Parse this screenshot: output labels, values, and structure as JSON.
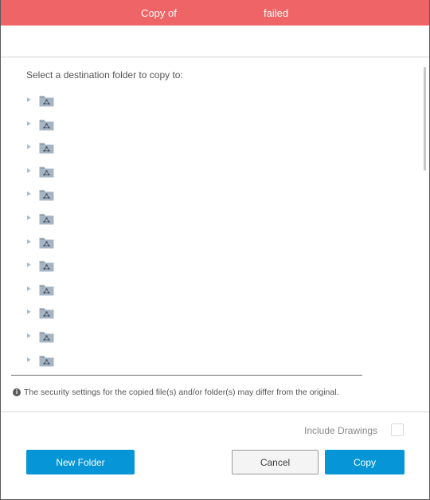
{
  "banner": {
    "copy_of": "Copy of",
    "status": "failed",
    "color": "#ef6466"
  },
  "prompt": "Select a destination folder to copy to:",
  "tree": {
    "items": [
      {
        "icon": "shared-folder-icon",
        "expandable": true
      },
      {
        "icon": "shared-folder-icon",
        "expandable": true
      },
      {
        "icon": "shared-folder-icon",
        "expandable": true
      },
      {
        "icon": "shared-folder-icon",
        "expandable": true
      },
      {
        "icon": "shared-folder-icon",
        "expandable": true
      },
      {
        "icon": "shared-folder-icon",
        "expandable": true
      },
      {
        "icon": "shared-folder-icon",
        "expandable": true
      },
      {
        "icon": "shared-folder-icon",
        "expandable": true
      },
      {
        "icon": "shared-folder-icon",
        "expandable": true
      },
      {
        "icon": "shared-folder-icon",
        "expandable": true
      },
      {
        "icon": "shared-folder-icon",
        "expandable": true
      },
      {
        "icon": "shared-folder-icon",
        "expandable": true
      },
      {
        "icon": "shared-folder-icon",
        "expandable": true
      }
    ]
  },
  "notice": {
    "icon": "info-icon",
    "text": "The security settings for the copied file(s) and/or folder(s) may differ from the original."
  },
  "options": {
    "include_drawings_label": "Include Drawings",
    "include_drawings_checked": false
  },
  "buttons": {
    "new_folder": "New Folder",
    "cancel": "Cancel",
    "copy": "Copy"
  },
  "colors": {
    "primary": "#0696d7",
    "banner": "#ef6466"
  }
}
